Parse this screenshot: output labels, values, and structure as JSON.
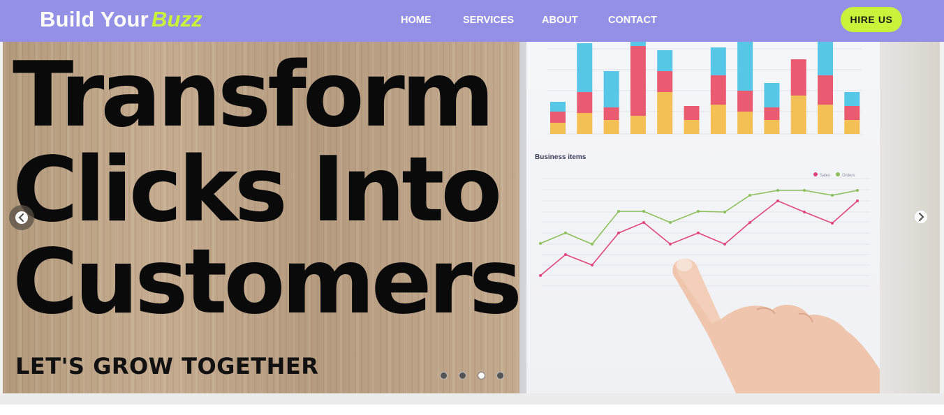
{
  "brand": {
    "text_main": "Build Your",
    "text_accent": "Buzz",
    "accent_color": "#c9f23b"
  },
  "nav": {
    "bg_color": "#9490e6",
    "links": [
      {
        "label": "HOME"
      },
      {
        "label": "SERVICES"
      },
      {
        "label": "ABOUT"
      },
      {
        "label": "CONTACT"
      }
    ],
    "hire_label": "HIRE US"
  },
  "hero": {
    "line1": "Transform",
    "line2": "Clicks Into",
    "line3": "Customers",
    "tagline": "LET'S GROW TOGETHER",
    "image_chart_title": "Business items",
    "image_legend": [
      "Sales",
      "Orders"
    ],
    "prev_icon": "chevron-left-icon",
    "next_icon": "chevron-right-icon",
    "slides_total": 4,
    "active_slide": 3
  }
}
